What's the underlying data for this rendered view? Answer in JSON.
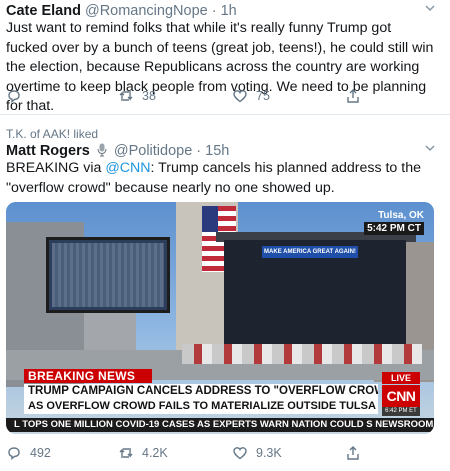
{
  "tweet1": {
    "name": "Cate Eland",
    "handle": "@RomancingNope",
    "dot": "·",
    "time": "1h",
    "text": "Just want to remind folks that while it's really funny Trump got fucked over by a bunch of teens (great job, teens!), he could still win the election, because Republicans across the country are working overtime to keep black people from voting. We need to be planning for that.",
    "replies": "",
    "retweets": "38",
    "likes": "75",
    "icons": {
      "reply": "reply-icon",
      "retweet": "retweet-icon",
      "like": "heart-icon",
      "share": "share-icon",
      "menu": "chevron-down-icon"
    }
  },
  "tweet2": {
    "context": "T.K. of AAK! liked",
    "name": "Matt Rogers",
    "handle": "@Politidope",
    "dot": "·",
    "time": "15h",
    "text_prefix": "BREAKING via ",
    "text_link": "@CNN",
    "text_suffix": ": Trump cancels his planned address to the \"overflow crowd\" because nearly no one showed up.",
    "media": {
      "location_city": "Tulsa, OK",
      "location_time": "5:42 PM CT",
      "stage_banner": "MAKE AMERICA GREAT AGAIN!",
      "breaking_label": "BREAKING NEWS",
      "headline_line1": "TRUMP CAMPAIGN CANCELS ADDRESS TO \"OVERFLOW CROWD,\"",
      "headline_line2": "AS OVERFLOW CROWD FAILS TO MATERIALIZE OUTSIDE TULSA RALLY",
      "live_label": "LIVE",
      "network_logo": "CNN",
      "network_time": "6:42 PM ET",
      "ticker": "L TOPS ONE MILLION COVID-19 CASES AS EXPERTS WARN NATION COULD S",
      "ticker_tag": "NEWSROOM"
    },
    "replies": "492",
    "retweets": "4.2K",
    "likes": "9.3K",
    "icons": {
      "reply": "reply-icon",
      "retweet": "retweet-icon",
      "like": "heart-icon",
      "share": "share-icon",
      "menu": "chevron-down-icon",
      "badge": "microphone-icon"
    }
  },
  "colors": {
    "text": "#14171a",
    "muted": "#657786",
    "link": "#1b95e0",
    "divider": "#e1e8ed",
    "cnn_red": "#cc0000"
  }
}
